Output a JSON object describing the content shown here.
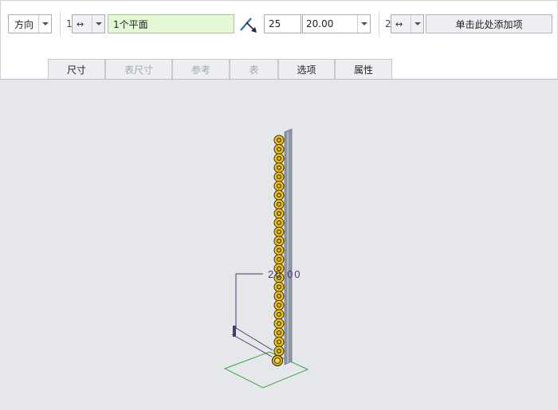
{
  "toolbar": {
    "direction_label": "方向",
    "ref1_index": "1",
    "ref1_value": "1个平面",
    "count_value": "25",
    "spacing_value": "20.00",
    "ref2_index": "2",
    "ref2_placeholder": "单击此处添加项"
  },
  "tabs": [
    {
      "label": "尺寸",
      "enabled": true
    },
    {
      "label": "表尺寸",
      "enabled": false
    },
    {
      "label": "参考",
      "enabled": false
    },
    {
      "label": "表",
      "enabled": false
    },
    {
      "label": "选项",
      "enabled": true
    },
    {
      "label": "属性",
      "enabled": true
    }
  ],
  "viewport": {
    "dimension_value": "20.00",
    "pattern_member_count": 25,
    "colors": {
      "marker_fill": "#f5c400",
      "marker_ring": "#33302a",
      "plane": "#3aa63a",
      "dimension": "#4a3a6e",
      "bar": "#8e96a3"
    }
  }
}
